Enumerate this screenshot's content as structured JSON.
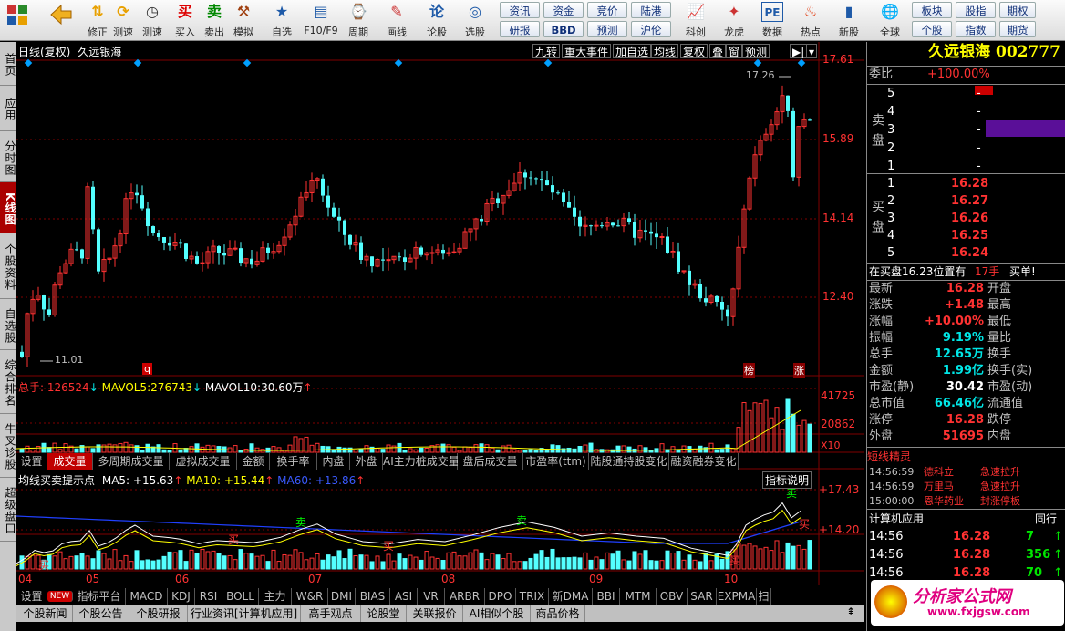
{
  "toolbar": {
    "buttons": [
      {
        "icon": "grid-icon",
        "label": "",
        "color": "#c33"
      },
      {
        "icon": "back-arrow-icon",
        "label": "",
        "color": "#e8a000"
      },
      {
        "icon": "arrows-up-down-icon",
        "label": "修正"
      },
      {
        "icon": "refresh-icon",
        "label": "测速"
      },
      {
        "icon": "clock-icon",
        "label": "测速2"
      },
      {
        "icon": "buy-icon",
        "label": "买入",
        "glyph": "买"
      },
      {
        "icon": "sell-icon",
        "label": "卖出",
        "glyph": "卖"
      },
      {
        "icon": "hammer-icon",
        "label": "模拟"
      },
      {
        "icon": "star-icon",
        "label": "自选"
      },
      {
        "icon": "window-icon",
        "label": "F10/F9"
      },
      {
        "icon": "period-icon",
        "label": "周期"
      },
      {
        "icon": "pencil-icon",
        "label": "画线"
      },
      {
        "icon": "stock-talk-icon",
        "label": "论股",
        "glyph": "论"
      },
      {
        "icon": "select-stock-icon",
        "label": "选股"
      }
    ],
    "grid": [
      [
        "资讯",
        "资金",
        "竞价",
        "陆港"
      ],
      [
        "研报",
        "BBD",
        "预测",
        "沪伦"
      ]
    ],
    "buttons2": [
      {
        "icon": "chart-compare-icon",
        "label": "科创"
      },
      {
        "icon": "dragon-tiger-icon",
        "label": "龙虎"
      },
      {
        "icon": "pe-icon",
        "label": "数据",
        "glyph": "PE"
      },
      {
        "icon": "hot-icon",
        "label": "热点"
      },
      {
        "icon": "new-stock-icon",
        "label": "新股"
      },
      {
        "icon": "globe-icon",
        "label": "全球"
      }
    ],
    "grid2": [
      [
        "板块",
        "股指",
        "期权"
      ],
      [
        "个股",
        "指数",
        "期货"
      ]
    ]
  },
  "sidebar": [
    "首页",
    "应用",
    "分时图",
    "K线图",
    "个股资料",
    "自选股",
    "综合排名",
    "牛叉诊股",
    "超级盘口"
  ],
  "chart": {
    "title": "日线(复权)",
    "stock_name": "久远银海",
    "top_buttons": [
      "九转",
      "重大事件",
      "加自选",
      "均线",
      "复权",
      "叠",
      "窗",
      "预测"
    ],
    "price_axis": [
      "17.61",
      "15.89",
      "14.14",
      "12.40"
    ],
    "high_label": "17.26",
    "low_label": "11.01",
    "markers": [
      "q",
      "榜",
      "涨"
    ],
    "volume_header": {
      "total_label": "总手",
      "total": "126524",
      "ma5_label": "MAVOL5:",
      "ma5": "276743",
      "ma10_label": "MAVOL10:",
      "ma10": "30.60万"
    },
    "volume_axis": [
      "41725",
      "20862",
      "X10"
    ],
    "tabs1": [
      "设置",
      "成交量",
      "多周期成交量",
      "虚拟成交量",
      "金额",
      "换手率",
      "内盘",
      "外盘",
      "AI主力桩成交量",
      "盘后成交量",
      "市盈率(ttm)",
      "陆股通持股变化",
      "融资融券变化"
    ],
    "indicator_header": {
      "name": "均线买卖提示点",
      "ma5": "MA5: +15.63",
      "ma10": "MA10: +15.44",
      "ma60": "MA60: +13.86",
      "explain": "指标说明"
    },
    "indicator_axis": [
      "+17.43",
      "+14.20"
    ],
    "signals": [
      "卖",
      "卖",
      "卖",
      "买",
      "买",
      "买",
      "买",
      "买"
    ],
    "months": [
      "04",
      "05",
      "06",
      "07",
      "08",
      "09",
      "10"
    ],
    "bottom_tabs": [
      "设置",
      "NEW",
      "指标平台",
      "MACD",
      "KDJ",
      "RSI",
      "BOLL",
      "主力",
      "W&R",
      "DMI",
      "BIAS",
      "ASI",
      "VR",
      "ARBR",
      "DPO",
      "TRIX",
      "新DMA",
      "BBI",
      "MTM",
      "OBV",
      "SAR",
      "EXPMA",
      "扫"
    ],
    "news_tabs": [
      "个股新闻",
      "个股公告",
      "个股研报",
      "行业资讯[计算机应用]",
      "高手观点",
      "论股堂",
      "关联报价",
      "AI相似个股",
      "商品价格"
    ]
  },
  "chart_data": {
    "type": "candlestick",
    "high": 17.26,
    "low": 11.01,
    "ylim": [
      11.0,
      17.61
    ]
  },
  "right": {
    "title": "久远银海 002777",
    "weibi_label": "委比",
    "weibi": "+100.00%",
    "sell_label": "卖盘",
    "buy_label": "买盘",
    "asks": [
      {
        "n": "5",
        "p": "",
        "v": "-"
      },
      {
        "n": "4",
        "p": "",
        "v": "-"
      },
      {
        "n": "3",
        "p": "",
        "v": "-"
      },
      {
        "n": "2",
        "p": "",
        "v": "-"
      },
      {
        "n": "1",
        "p": "",
        "v": "-"
      }
    ],
    "bids": [
      {
        "n": "1",
        "p": "16.28"
      },
      {
        "n": "2",
        "p": "16.27"
      },
      {
        "n": "3",
        "p": "16.26"
      },
      {
        "n": "4",
        "p": "16.25"
      },
      {
        "n": "5",
        "p": "16.24"
      }
    ],
    "buyline": "在买盘16.23位置有",
    "buyline_vol": "17手",
    "buyline_act": "买单!",
    "stats": [
      [
        "最新",
        "16.28",
        "开盘",
        ""
      ],
      [
        "涨跌",
        "+1.48",
        "最高",
        ""
      ],
      [
        "涨幅",
        "+10.00%",
        "最低",
        ""
      ],
      [
        "振幅",
        "9.19%",
        "量比",
        ""
      ],
      [
        "总手",
        "12.65万",
        "换手",
        ""
      ],
      [
        "金额",
        "1.99亿",
        "换手(实)",
        ""
      ],
      [
        "市盈(静)",
        "30.42",
        "市盈(动)",
        ""
      ],
      [
        "总市值",
        "66.46亿",
        "流通值",
        ""
      ],
      [
        "涨停",
        "16.28",
        "跌停",
        ""
      ],
      [
        "外盘",
        "51695",
        "内盘",
        ""
      ]
    ],
    "elf_title": "短线精灵",
    "elf": [
      [
        "14:56:59",
        "德科立",
        "急速拉升"
      ],
      [
        "14:56:59",
        "万里马",
        "急速拉升"
      ],
      [
        "15:00:00",
        "恩华药业",
        "封涨停板"
      ]
    ],
    "sector": "计算机应用",
    "sector_right": "同行",
    "ticks": [
      [
        "14:56",
        "16.28",
        "7"
      ],
      [
        "14:56",
        "16.28",
        "356"
      ],
      [
        "14:56",
        "16.28",
        "70"
      ]
    ],
    "watermark": "分析家公式网",
    "watermark_url": "www.fxjgsw.com"
  }
}
